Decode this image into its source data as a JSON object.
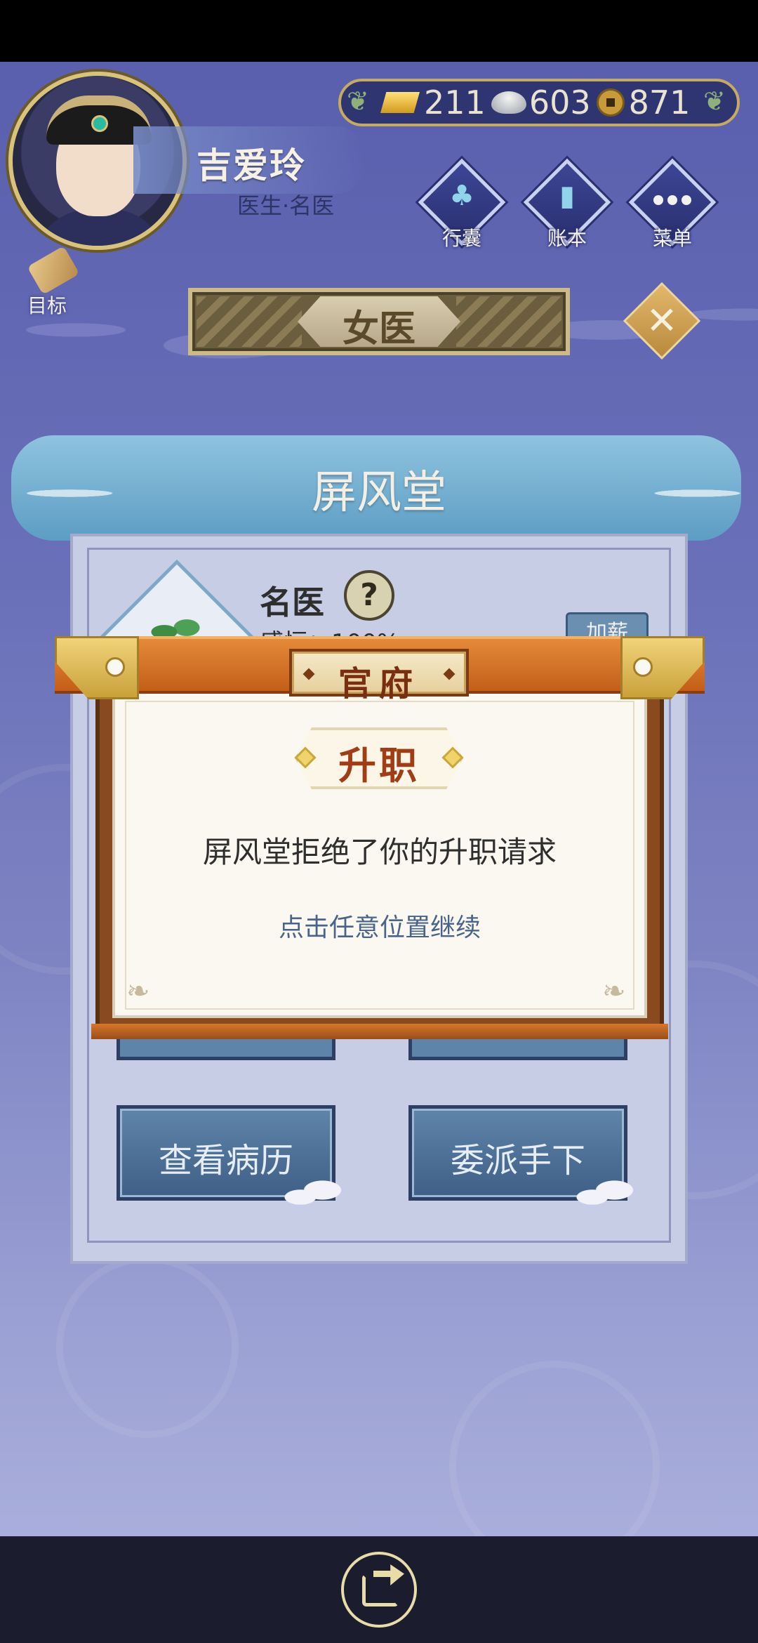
{
  "player": {
    "name": "吉爱玲",
    "title": "医生·名医"
  },
  "currency": {
    "gold": "211",
    "silver": "603",
    "copper": "871"
  },
  "nav": {
    "bag": "行囊",
    "ledger": "账本",
    "menu": "菜单",
    "goal": "目标"
  },
  "tab": {
    "label": "女医"
  },
  "hall": {
    "name": "屏风堂",
    "rank": "名医",
    "help": "?",
    "raise": "加薪",
    "partial_line": "感恒：100%",
    "buttons": {
      "records": "查看病历",
      "delegate": "委派手下"
    }
  },
  "modal": {
    "header": "官府",
    "title": "升职",
    "message": "屏风堂拒绝了你的升职请求",
    "hint": "点击任意位置继续"
  },
  "icons": {
    "share": "share-icon",
    "close": "close-icon"
  },
  "colors": {
    "background": "#6a70b8",
    "modal_header": "#d5702a",
    "modal_text_title": "#a23c14",
    "hint": "#4a6489"
  }
}
